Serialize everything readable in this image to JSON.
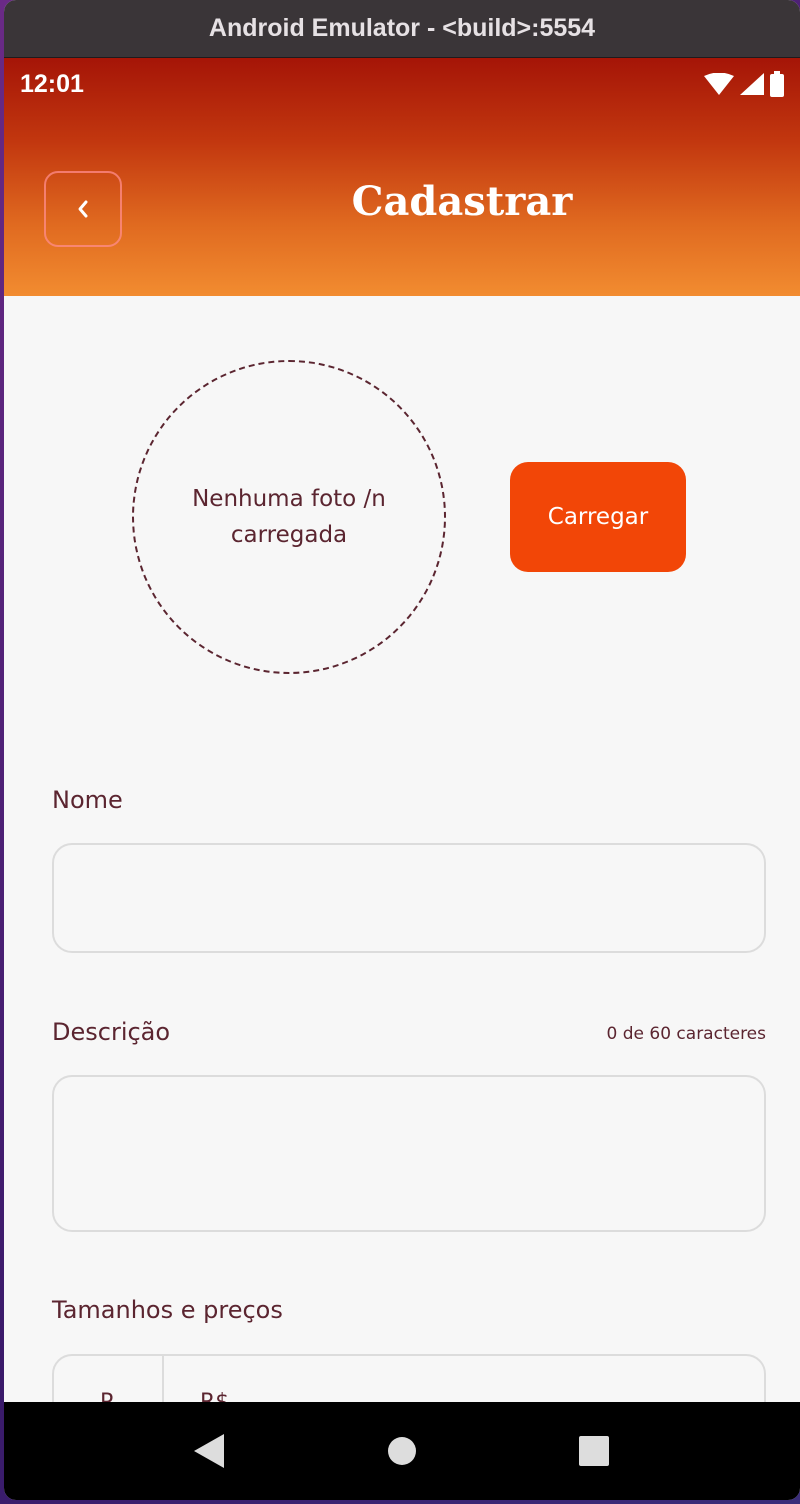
{
  "window": {
    "title": "Android Emulator - <build>:5554"
  },
  "status_bar": {
    "time": "12:01",
    "icons": [
      "wifi-icon",
      "signal-icon",
      "battery-icon"
    ]
  },
  "header": {
    "title": "Cadastrar",
    "back_icon": "chevron-left-icon"
  },
  "photo": {
    "placeholder": "Nenhuma foto /n carregada",
    "upload_label": "Carregar"
  },
  "form": {
    "name_label": "Nome",
    "name_value": "",
    "description_label": "Descrição",
    "description_counter": "0 de 60 caracteres",
    "description_value": "",
    "sizes_label": "Tamanhos e preços",
    "sizes_row": {
      "size": "P",
      "price_prefix": "R$"
    }
  },
  "nav_bar": {
    "icons": [
      "back-triangle-icon",
      "home-circle-icon",
      "recents-square-icon"
    ]
  },
  "colors": {
    "accent": "#F24607",
    "text": "#5B2530",
    "header_top": "#A51507",
    "header_bottom": "#F28C30"
  }
}
